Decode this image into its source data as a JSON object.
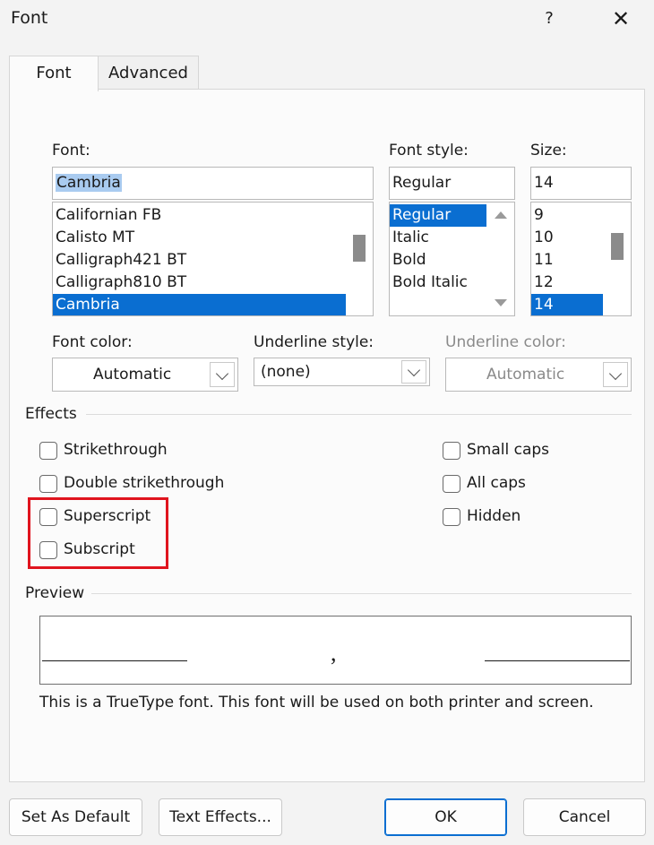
{
  "window": {
    "title": "Font",
    "help": "?",
    "close": "✕"
  },
  "tabs": [
    {
      "label": "Font",
      "active": true
    },
    {
      "label": "Advanced",
      "active": false
    }
  ],
  "font": {
    "label": "Font:",
    "value": "Cambria",
    "items": [
      "Californian FB",
      "Calisto MT",
      "Calligraph421 BT",
      "Calligraph810 BT",
      "Cambria"
    ]
  },
  "font_style": {
    "label": "Font style:",
    "value": "Regular",
    "items": [
      "Regular",
      "Italic",
      "Bold",
      "Bold Italic"
    ]
  },
  "size": {
    "label": "Size:",
    "value": "14",
    "items": [
      "9",
      "10",
      "11",
      "12",
      "14"
    ]
  },
  "font_color": {
    "label": "Font color:",
    "value": "Automatic"
  },
  "underline_style": {
    "label": "Underline style:",
    "value": "(none)"
  },
  "underline_color": {
    "label": "Underline color:",
    "value": "Automatic"
  },
  "effects": {
    "label": "Effects",
    "left": [
      "Strikethrough",
      "Double strikethrough",
      "Superscript",
      "Subscript"
    ],
    "right": [
      "Small caps",
      "All caps",
      "Hidden"
    ]
  },
  "preview": {
    "label": "Preview",
    "sample": ",",
    "note": "This is a TrueType font. This font will be used on both printer and screen."
  },
  "buttons": {
    "set_default": "Set As Default",
    "text_effects": "Text Effects...",
    "ok": "OK",
    "cancel": "Cancel"
  },
  "colors": {
    "selection": "#0a6ed1",
    "highlight": "#e0141e"
  }
}
